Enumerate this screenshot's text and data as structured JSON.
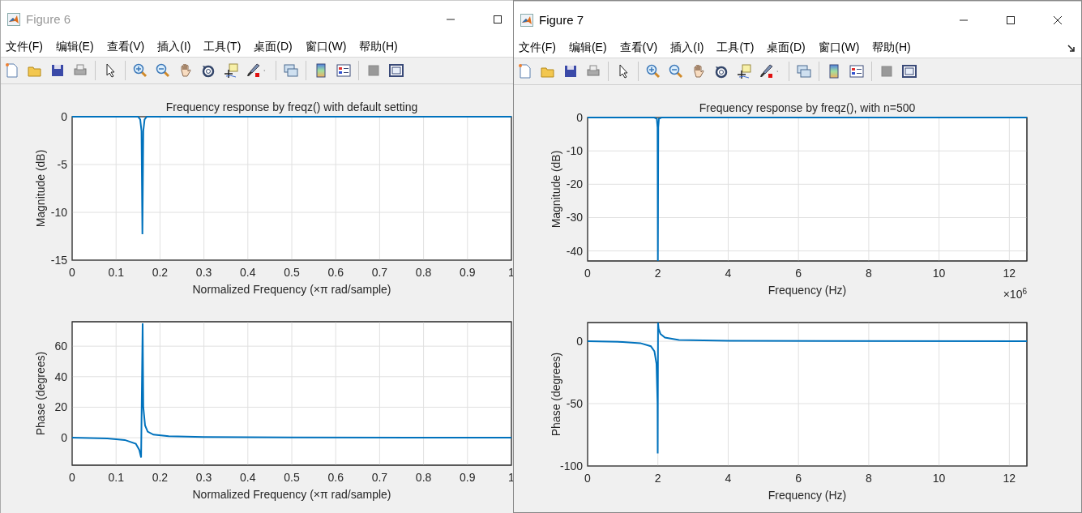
{
  "windows": [
    {
      "title": "Figure 6",
      "active": false,
      "menu": [
        "文件(F)",
        "编辑(E)",
        "查看(V)",
        "插入(I)",
        "工具(T)",
        "桌面(D)",
        "窗口(W)",
        "帮助(H)"
      ],
      "axes": [
        {
          "chart_data": {
            "type": "line",
            "title": "Frequency response by freqz() with default setting",
            "xlabel": "Normalized Frequency  (×π rad/sample)",
            "ylabel": "Magnitude (dB)",
            "grid": true,
            "xlim": [
              0,
              1
            ],
            "ylim": [
              -15,
              0
            ],
            "xticks": [
              0,
              0.1,
              0.2,
              0.3,
              0.4,
              0.5,
              0.6,
              0.7,
              0.8,
              0.9,
              1
            ],
            "yticks": [
              0,
              -5,
              -10,
              -15
            ],
            "x": [
              0,
              0.15,
              0.155,
              0.158,
              0.16,
              0.162,
              0.165,
              0.17,
              1
            ],
            "series": [
              {
                "color": "#0072bd",
                "values": [
                  0,
                  0,
                  -0.3,
                  -1.5,
                  -12.3,
                  -1.5,
                  -0.3,
                  0,
                  0
                ]
              }
            ]
          }
        },
        {
          "chart_data": {
            "type": "line",
            "xlabel": "Normalized Frequency  (×π rad/sample)",
            "ylabel": "Phase (degrees)",
            "grid": true,
            "xlim": [
              0,
              1
            ],
            "ylim": [
              -18,
              76
            ],
            "xticks": [
              0,
              0.1,
              0.2,
              0.3,
              0.4,
              0.5,
              0.6,
              0.7,
              0.8,
              0.9,
              1
            ],
            "yticks": [
              0,
              20,
              40,
              60
            ],
            "x": [
              0,
              0.08,
              0.12,
              0.145,
              0.153,
              0.157,
              0.1605,
              0.162,
              0.166,
              0.172,
              0.185,
              0.22,
              0.3,
              0.5,
              1
            ],
            "series": [
              {
                "color": "#0072bd",
                "values": [
                  0,
                  -0.5,
                  -1.5,
                  -4,
                  -8,
                  -13,
                  75,
                  20,
                  8,
                  4,
                  2,
                  1,
                  0.5,
                  0.2,
                  0
                ]
              }
            ]
          }
        }
      ]
    },
    {
      "title": "Figure 7",
      "active": true,
      "menu": [
        "文件(F)",
        "编辑(E)",
        "查看(V)",
        "插入(I)",
        "工具(T)",
        "桌面(D)",
        "窗口(W)",
        "帮助(H)"
      ],
      "axes": [
        {
          "chart_data": {
            "type": "line",
            "title": "Frequency response by freqz(), with n=500",
            "xlabel": "Frequency (Hz)",
            "ylabel": "Magnitude (dB)",
            "grid": true,
            "xlim": [
              0,
              12.5
            ],
            "ylim": [
              -43,
              0
            ],
            "xticks": [
              0,
              2,
              4,
              6,
              8,
              10,
              12
            ],
            "yticks": [
              0,
              -10,
              -20,
              -30,
              -40
            ],
            "x": [
              0,
              1.9,
              1.97,
              1.99,
              2,
              2.01,
              2.03,
              2.1,
              12.5
            ],
            "series": [
              {
                "color": "#0072bd",
                "values": [
                  0,
                  0,
                  -0.4,
                  -3,
                  -43,
                  -3,
                  -0.4,
                  0,
                  0
                ]
              }
            ]
          },
          "x_multiplier": {
            "base": "×10",
            "power": "6"
          }
        },
        {
          "chart_data": {
            "type": "line",
            "xlabel": "Frequency (Hz)",
            "ylabel": "Phase (degrees)",
            "grid": true,
            "xlim": [
              0,
              12.5
            ],
            "ylim": [
              -100,
              15
            ],
            "xticks": [
              0,
              2,
              4,
              6,
              8,
              10,
              12
            ],
            "yticks": [
              -100,
              -50,
              0
            ],
            "x": [
              0,
              1,
              1.5,
              1.8,
              1.9,
              1.96,
              1.99,
              1.995,
              2.005,
              2.02,
              2.07,
              2.2,
              2.6,
              4,
              12.5
            ],
            "series": [
              {
                "color": "#0072bd",
                "values": [
                  0,
                  -0.5,
                  -1.5,
                  -4,
                  -8,
                  -18,
                  -50,
                  -90,
                  15,
                  10,
                  6,
                  3,
                  1,
                  0.3,
                  0
                ]
              }
            ]
          }
        }
      ]
    }
  ]
}
